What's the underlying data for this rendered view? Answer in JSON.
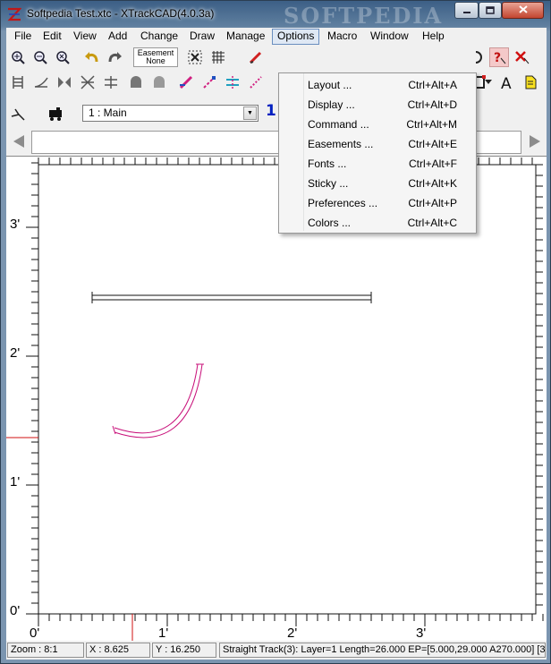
{
  "window": {
    "title": "Softpedia Test.xtc - XTrackCAD(4.0.3a)",
    "watermark": "SOFTPEDIA"
  },
  "menubar": {
    "items": [
      {
        "label": "File"
      },
      {
        "label": "Edit"
      },
      {
        "label": "View"
      },
      {
        "label": "Add"
      },
      {
        "label": "Change"
      },
      {
        "label": "Draw"
      },
      {
        "label": "Manage"
      },
      {
        "label": "Options"
      },
      {
        "label": "Macro"
      },
      {
        "label": "Window"
      },
      {
        "label": "Help"
      }
    ],
    "active": "Options"
  },
  "options_menu": {
    "items": [
      {
        "label": "Layout ...",
        "shortcut": "Ctrl+Alt+A"
      },
      {
        "label": "Display ...",
        "shortcut": "Ctrl+Alt+D"
      },
      {
        "label": "Command ...",
        "shortcut": "Ctrl+Alt+M"
      },
      {
        "label": "Easements ...",
        "shortcut": "Ctrl+Alt+E"
      },
      {
        "label": "Fonts ...",
        "shortcut": "Ctrl+Alt+F"
      },
      {
        "label": "Sticky ...",
        "shortcut": "Ctrl+Alt+K"
      },
      {
        "label": "Preferences ...",
        "shortcut": "Ctrl+Alt+P"
      },
      {
        "label": "Colors ...",
        "shortcut": "Ctrl+Alt+C"
      }
    ]
  },
  "toolbar": {
    "easement_label": "Easement",
    "easement_value": "None",
    "layer_select": "1 : Main",
    "layer_number": "1"
  },
  "canvas": {
    "y_labels": [
      "3'",
      "2'",
      "1'",
      "0'"
    ],
    "x_labels": [
      "0'",
      "1'",
      "2'",
      "3'"
    ],
    "track_color": "#c8107a",
    "marker_color": "#d01010"
  },
  "statusbar": {
    "zoom": "Zoom : 8:1",
    "x": "X : 8.625",
    "y": "Y : 16.250",
    "info": "Straight Track(3): Layer=1 Length=26.000 EP=[5.000,29.000 A270.000] [3"
  }
}
